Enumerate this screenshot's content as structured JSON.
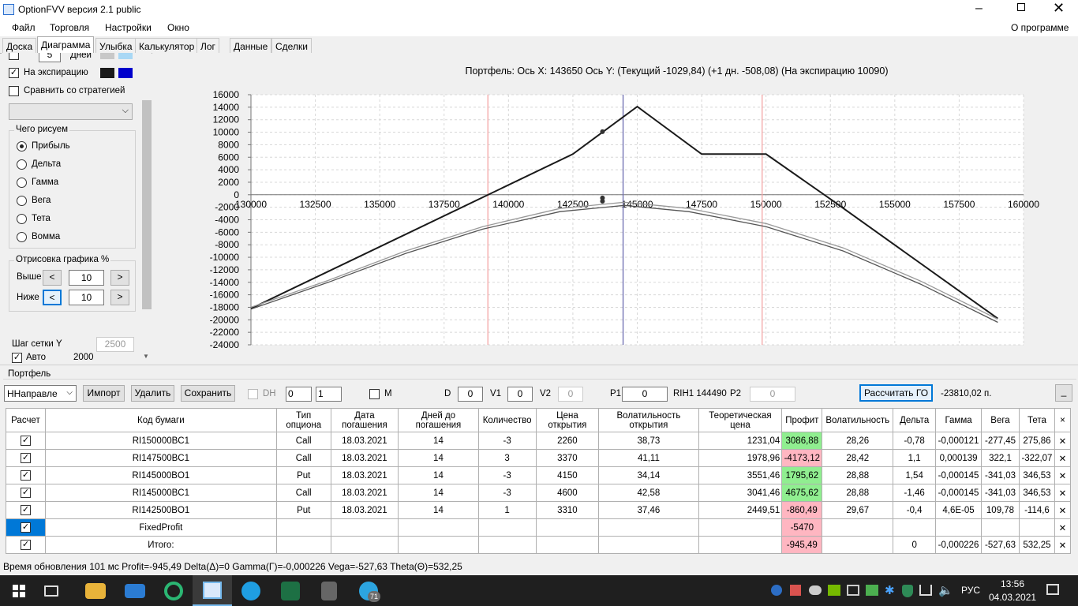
{
  "window": {
    "title": "OptionFVV версия 2.1 public"
  },
  "menu": {
    "items": [
      "Файл",
      "Торговля",
      "Настройки",
      "Окно"
    ],
    "about": "О программе"
  },
  "tabs": [
    "Доска",
    "Диаграмма",
    "Улыбка",
    "Калькулятор",
    "Лог",
    "Данные",
    "Сделки"
  ],
  "left": {
    "days_label": "Дней",
    "days_value": "5",
    "expiration_label": "На экспирацию",
    "compare_label": "Сравнить со стратегией",
    "draw_group": "Чего рисуем",
    "options": [
      "Прибыль",
      "Дельта",
      "Гамма",
      "Вега",
      "Тета",
      "Вомма"
    ],
    "render_group": "Отрисовка графика %",
    "above_label": "Выше",
    "above_value": "10",
    "below_label": "Ниже",
    "below_value": "10",
    "grid_step_label": "Шаг сетки Y",
    "grid_step_value": "2500",
    "auto_label": "Авто",
    "auto_value": "2000"
  },
  "chart_data": {
    "type": "line",
    "title": "Портфель: Ось X: 143650 Ось Y:  (Текущий -1029,84)  (+1 дн. -508,08)  (На экспирацию 10090)",
    "xlim": [
      130000,
      160000
    ],
    "ylim": [
      -24000,
      16000
    ],
    "x_ticks": [
      130000,
      132500,
      135000,
      137500,
      140000,
      142500,
      145000,
      147500,
      150000,
      152500,
      155000,
      157500,
      160000
    ],
    "y_ticks": [
      16000,
      14000,
      12000,
      10000,
      8000,
      6000,
      4000,
      2000,
      0,
      -2000,
      -4000,
      -6000,
      -8000,
      -10000,
      -12000,
      -14000,
      -16000,
      -18000,
      -20000,
      -22000,
      -24000
    ],
    "vlines": [
      {
        "x": 139200,
        "color": "#f4a6a6"
      },
      {
        "x": 144450,
        "color": "#6b6bb0"
      },
      {
        "x": 149850,
        "color": "#f4a6a6"
      }
    ],
    "series": [
      {
        "color": "#1a1a1a",
        "points": [
          [
            130000,
            -18200
          ],
          [
            142500,
            6500
          ],
          [
            145000,
            14100
          ],
          [
            147500,
            6500
          ],
          [
            150000,
            6500
          ],
          [
            152500,
            -700
          ],
          [
            159000,
            -19800
          ]
        ],
        "marker": [
          143650,
          10090
        ]
      },
      {
        "color": "#999999",
        "points": [
          [
            130000,
            -18000
          ],
          [
            133000,
            -13700
          ],
          [
            136000,
            -9000
          ],
          [
            139000,
            -5100
          ],
          [
            142000,
            -2200
          ],
          [
            144500,
            -1200
          ],
          [
            147000,
            -2200
          ],
          [
            150000,
            -4600
          ],
          [
            153000,
            -8500
          ],
          [
            156000,
            -13800
          ],
          [
            159000,
            -19900
          ]
        ],
        "marker": [
          143650,
          -508
        ]
      },
      {
        "color": "#555555",
        "points": [
          [
            130000,
            -18300
          ],
          [
            133000,
            -14000
          ],
          [
            136000,
            -9400
          ],
          [
            139000,
            -5500
          ],
          [
            142000,
            -2700
          ],
          [
            144500,
            -1700
          ],
          [
            147000,
            -2700
          ],
          [
            150000,
            -5100
          ],
          [
            153000,
            -9000
          ],
          [
            156000,
            -14300
          ],
          [
            159000,
            -20400
          ]
        ],
        "marker": [
          143650,
          -1030
        ]
      }
    ]
  },
  "portfolio": {
    "label": "Портфель",
    "name": "ННаправле",
    "import": "Импорт",
    "delete": "Удалить",
    "save": "Сохранить",
    "dh_label": "DH",
    "dh_v1": "0",
    "dh_v2": "1",
    "m_label": "M",
    "d_label": "D",
    "d_value": "0",
    "v1_label": "V1",
    "v1_value": "0",
    "v2_label": "V2",
    "v2_value": "0",
    "p1_label": "P1",
    "p1_value": "0",
    "instrument": "RIH1 144490",
    "p2_label": "P2",
    "p2_value": "0",
    "calc_go": "Рассчитать ГО",
    "go_value": "-23810,02 п.",
    "min_btn": "_"
  },
  "table": {
    "headers": [
      "Расчет",
      "Код бумаги",
      "Тип опциона",
      "Дата погашения",
      "Дней до погашения",
      "Количество",
      "Цена открытия",
      "Волатильность открытия",
      "Теоретическая цена",
      "Профит",
      "Волатильность",
      "Дельта",
      "Гамма",
      "Вега",
      "Тета",
      "×"
    ],
    "rows": [
      [
        "RI150000BC1",
        "Call",
        "18.03.2021",
        "14",
        "-3",
        "2260",
        "38,73",
        "1231,04",
        "3086,88",
        "28,26",
        "-0,78",
        "-0,000121",
        "-277,45",
        "275,86"
      ],
      [
        "RI147500BC1",
        "Call",
        "18.03.2021",
        "14",
        "3",
        "3370",
        "41,11",
        "1978,96",
        "-4173,12",
        "28,42",
        "1,1",
        "0,000139",
        "322,1",
        "-322,07"
      ],
      [
        "RI145000BO1",
        "Put",
        "18.03.2021",
        "14",
        "-3",
        "4150",
        "34,14",
        "3551,46",
        "1795,62",
        "28,88",
        "1,54",
        "-0,000145",
        "-341,03",
        "346,53"
      ],
      [
        "RI145000BC1",
        "Call",
        "18.03.2021",
        "14",
        "-3",
        "4600",
        "42,58",
        "3041,46",
        "4675,62",
        "28,88",
        "-1,46",
        "-0,000145",
        "-341,03",
        "346,53"
      ],
      [
        "RI142500BO1",
        "Put",
        "18.03.2021",
        "14",
        "1",
        "3310",
        "37,46",
        "2449,51",
        "-860,49",
        "29,67",
        "-0,4",
        "4,6E-05",
        "109,78",
        "-114,6"
      ],
      [
        "FixedProfit",
        "",
        "",
        "",
        "",
        "",
        "",
        "",
        "-5470",
        "",
        "",
        "",
        "",
        ""
      ],
      [
        "Итого:",
        "",
        "",
        "",
        "",
        "",
        "",
        "",
        "-945,49",
        "",
        "0",
        "-0,000226",
        "-527,63",
        "532,25"
      ]
    ],
    "profit_pos": [
      true,
      false,
      true,
      true,
      false,
      false,
      false
    ]
  },
  "status": "Время обновления 101 мс  Profit=-945,49 Delta(Δ)=0 Gamma(Γ)=-0,000226 Vega=-527,63 Theta(Θ)=532,25",
  "taskbar": {
    "lang": "РУС",
    "time": "13:56",
    "date": "04.03.2021",
    "badge": "71"
  }
}
